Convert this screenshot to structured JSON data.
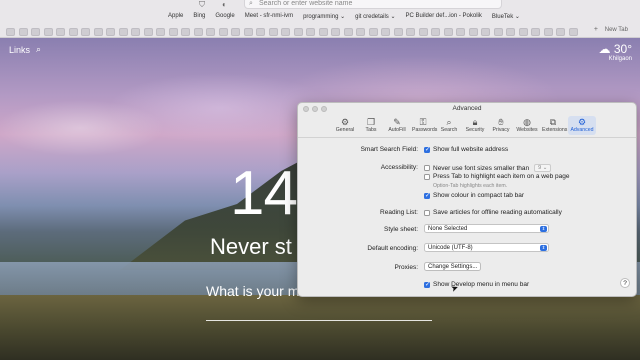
{
  "browser": {
    "address_placeholder": "Search or enter website name",
    "favorites": [
      "Apple",
      "Bing",
      "Google",
      "Meet - sfr-nmi-ivm",
      "programming ⌄",
      "git credetails ⌄",
      "PC Builder def...ion - Pokolik",
      "BlueTek ⌄"
    ],
    "new_tab_label": "New Tab"
  },
  "start_page": {
    "links_label": "Links",
    "weather": {
      "temperature": "30°",
      "city": "Khilgaon"
    },
    "time": "14",
    "headline": "Never st",
    "question": "What is your m"
  },
  "prefs": {
    "title": "Advanced",
    "tabs": [
      {
        "label": "General",
        "icon": "gear-icon"
      },
      {
        "label": "Tabs",
        "icon": "tabs-icon"
      },
      {
        "label": "AutoFill",
        "icon": "autofill-icon"
      },
      {
        "label": "Passwords",
        "icon": "key-icon"
      },
      {
        "label": "Search",
        "icon": "search-icon"
      },
      {
        "label": "Security",
        "icon": "lock-icon"
      },
      {
        "label": "Privacy",
        "icon": "hand-icon"
      },
      {
        "label": "Websites",
        "icon": "globe-icon"
      },
      {
        "label": "Extensions",
        "icon": "puzzle-icon"
      },
      {
        "label": "Advanced",
        "icon": "gears-icon"
      }
    ],
    "active_tab": "Advanced",
    "smart_search": {
      "label": "Smart Search Field:",
      "option": "Show full website address",
      "checked": true
    },
    "accessibility": {
      "label": "Accessibility:",
      "font_option": "Never use font sizes smaller than",
      "font_value": "9",
      "tab_option": "Press Tab to highlight each item on a web page",
      "tab_hint": "Option-Tab highlights each item.",
      "colour_option": "Show colour in compact tab bar",
      "colour_checked": true
    },
    "reading_list": {
      "label": "Reading List:",
      "option": "Save articles for offline reading automatically"
    },
    "style_sheet": {
      "label": "Style sheet:",
      "value": "None Selected"
    },
    "encoding": {
      "label": "Default encoding:",
      "value": "Unicode (UTF-8)"
    },
    "proxies": {
      "label": "Proxies:",
      "button": "Change Settings..."
    },
    "develop": {
      "option": "Show Develop menu in menu bar",
      "checked": true
    },
    "help": "?"
  }
}
